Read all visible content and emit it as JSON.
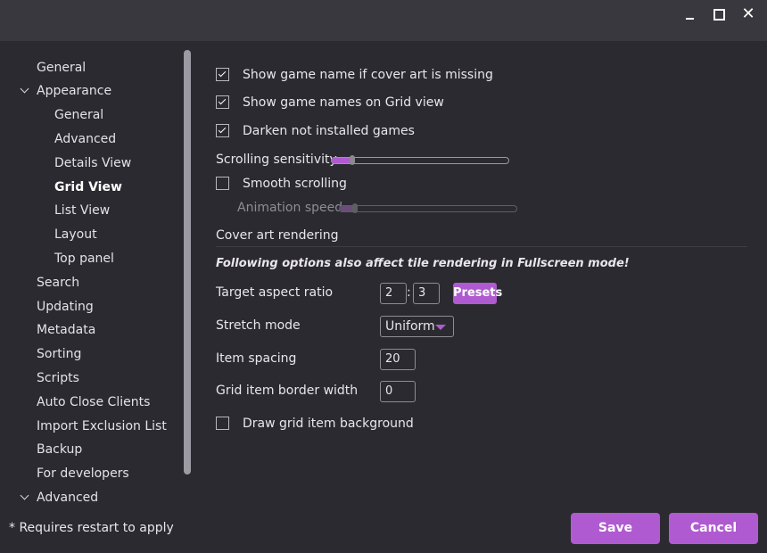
{
  "window": {
    "minimize_glyph": "",
    "close_glyph": "✕"
  },
  "sidebar": {
    "items": [
      {
        "label": "General"
      },
      {
        "label": "Appearance"
      },
      {
        "label": "General"
      },
      {
        "label": "Advanced"
      },
      {
        "label": "Details View"
      },
      {
        "label": "Grid View"
      },
      {
        "label": "List View"
      },
      {
        "label": "Layout"
      },
      {
        "label": "Top panel"
      },
      {
        "label": "Search"
      },
      {
        "label": "Updating"
      },
      {
        "label": "Metadata"
      },
      {
        "label": "Sorting"
      },
      {
        "label": "Scripts"
      },
      {
        "label": "Auto Close Clients"
      },
      {
        "label": "Import Exclusion List"
      },
      {
        "label": "Backup"
      },
      {
        "label": "For developers"
      },
      {
        "label": "Advanced"
      }
    ],
    "selected": "Grid View"
  },
  "settings": {
    "show_name_missing_cover": {
      "label": "Show game name if cover art is missing",
      "checked": true
    },
    "show_names_grid": {
      "label": "Show game names on Grid view",
      "checked": true
    },
    "darken_not_installed": {
      "label": "Darken not installed games",
      "checked": true
    },
    "scrolling_sensitivity": {
      "label": "Scrolling sensitivity",
      "level": 0.1
    },
    "smooth_scrolling": {
      "label": "Smooth scrolling",
      "checked": false
    },
    "animation_speed": {
      "label": "Animation speed",
      "level": 0.07,
      "disabled": true
    },
    "cover_section": "Cover art rendering",
    "cover_note": "Following options also affect tile rendering in Fullscreen mode!",
    "aspect_ratio": {
      "label": "Target aspect ratio",
      "width": "2",
      "separator": ":",
      "height": "3",
      "presets_label": "Presets"
    },
    "stretch_mode": {
      "label": "Stretch mode",
      "value": "Uniform"
    },
    "item_spacing": {
      "label": "Item spacing",
      "value": "20"
    },
    "border_width": {
      "label": "Grid item border width",
      "value": "0"
    },
    "draw_background": {
      "label": "Draw grid item background",
      "checked": false
    }
  },
  "footer": {
    "note": "* Requires restart to apply",
    "save_label": "Save",
    "cancel_label": "Cancel"
  },
  "colors": {
    "accent": "#b05ad1",
    "background": "#2b2a30",
    "titlebar": "#39383e"
  }
}
